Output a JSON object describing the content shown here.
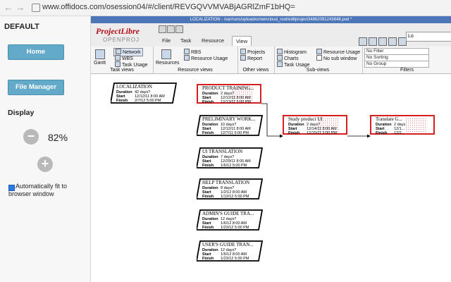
{
  "browser": {
    "url": "www.offidocs.com/osession04/#/client/REVGQVVMVABjAGRlZmF1bHQ="
  },
  "left_panel": {
    "title": "DEFAULT",
    "home_label": "Home",
    "file_manager_label": "File Manager",
    "display_label": "Display",
    "zoom_minus": "−",
    "zoom_value": "82%",
    "zoom_plus": "+",
    "autofit_label": "Automatically fit to browser window",
    "autofit_checked": true
  },
  "app": {
    "window_title": "LOCALIZATION - /var/runs/uploadxx/owncloud_root/editproject34862091243848.pod *",
    "logo_main": "ProjectLibre",
    "logo_sub": "OPENPROJ",
    "tabs": [
      "File",
      "Task",
      "Resource",
      "View"
    ],
    "active_tab": "View",
    "top_right_value": "Lo",
    "ribbon": {
      "task_views": {
        "label": "Task views",
        "gantt": "Gantt",
        "network": "Network",
        "wbs": "WBS",
        "task_usage": "Task Usage"
      },
      "resource_views": {
        "label": "Resource views",
        "resources": "Resources",
        "rbs": "RBS",
        "resource_usage": "Resource Usage"
      },
      "other_views": {
        "label": "Other views",
        "projects": "Projects",
        "report": "Report"
      },
      "sub_views": {
        "label": "Sub-views",
        "histogram": "Histogram",
        "charts": "Charts",
        "task_usage": "Task Usage",
        "resource_usage": "Resource Usage",
        "no_sub_window": "No sub window"
      },
      "filters": {
        "label": "Filters",
        "filter": "No Filter",
        "sorting": "No Sorting",
        "group": "No Group"
      }
    }
  },
  "network": {
    "labels": {
      "duration": "Duration",
      "start": "Start",
      "finish": "Finish"
    },
    "nodes": [
      {
        "title": "LOCALIZATION",
        "duration": "42 days?",
        "start": "12/12/11 8:00 AM",
        "finish": "2/7/12 5:00 PM",
        "selected": false
      },
      {
        "title": "PRODUCT TRAINING...",
        "duration": "2 days?",
        "start": "12/12/11 8:00 AM",
        "finish": "12/13/11 5:00 PM",
        "selected": true
      },
      {
        "title": "PRELIMINARY WORK...",
        "duration": "10 days?",
        "start": "12/12/11 8:00 AM",
        "finish": "12/7/11 5:00 PM",
        "selected": false
      },
      {
        "title": "UI TRANSLATION",
        "duration": "7 days?",
        "start": "12/29/11 8:00 AM",
        "finish": "1/6/12 5:00 PM",
        "selected": false
      },
      {
        "title": "HELP TRANSLATION",
        "duration": "8 days?",
        "start": "1/2/12 8:00 AM",
        "finish": "1/13/12 5:00 PM",
        "selected": false
      },
      {
        "title": "ADMIN'S GUIDE TRA...",
        "duration": "12 days?",
        "start": "1/6/12 8:00 AM",
        "finish": "1/23/12 5:00 PM",
        "selected": false
      },
      {
        "title": "USER'S GUIDE TRAN...",
        "duration": "12 days?",
        "start": "1/6/12 8:00 AM",
        "finish": "1/23/12 5:00 PM",
        "selected": false
      },
      {
        "title": "Study product UI",
        "duration": "2 days?",
        "start": "12/14/11 8:00 AM",
        "finish": "12/15/11 5:00 PM",
        "selected": true
      },
      {
        "title": "Translate G...",
        "duration": "2 days",
        "start": "12/1...",
        "finish": "12/2...",
        "selected": true
      }
    ]
  },
  "colors": {
    "accent_button": "#63a9c9",
    "title_bar": "#4d76b8",
    "selected_node": "#d42020",
    "logo": "#b1101a"
  }
}
